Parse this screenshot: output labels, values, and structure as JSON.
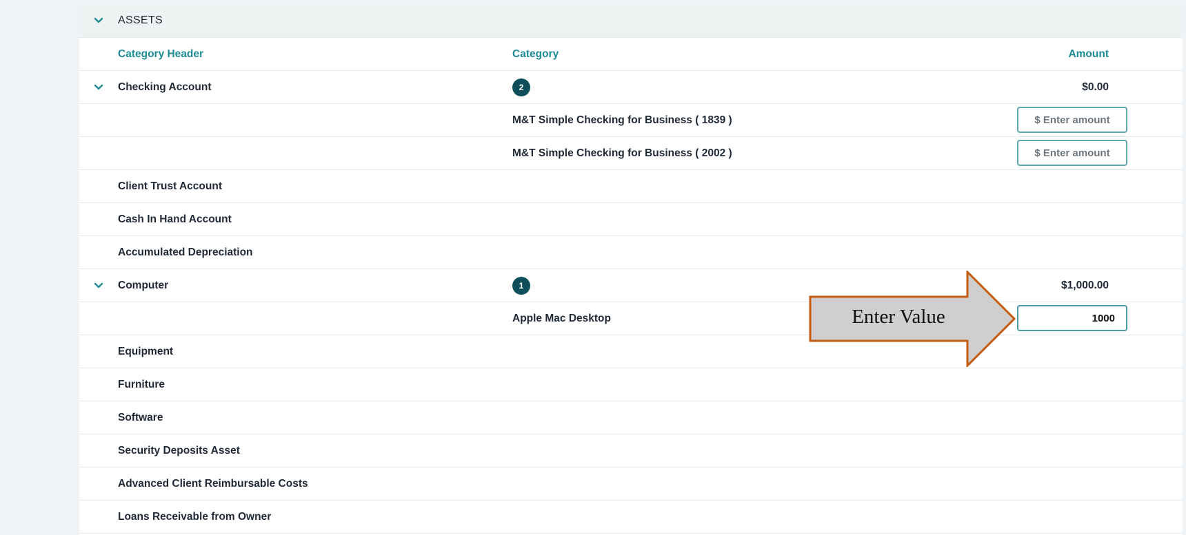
{
  "section": {
    "title": "ASSETS"
  },
  "columns": {
    "header": "Category Header",
    "category": "Category",
    "amount": "Amount"
  },
  "rows": {
    "checking": {
      "label": "Checking Account",
      "count": "2",
      "amount": "$0.00"
    },
    "checking_1": {
      "category": "M&T Simple Checking for Business ( 1839 )",
      "placeholder": "$ Enter amount",
      "value": ""
    },
    "checking_2": {
      "category": "M&T Simple Checking for Business ( 2002 )",
      "placeholder": "$ Enter amount",
      "value": ""
    },
    "client_trust": {
      "label": "Client Trust Account"
    },
    "cash_in_hand": {
      "label": "Cash In Hand Account"
    },
    "accum_dep": {
      "label": "Accumulated Depreciation"
    },
    "computer": {
      "label": "Computer",
      "count": "1",
      "amount": "$1,000.00"
    },
    "computer_1": {
      "category": "Apple Mac Desktop",
      "value": "1000"
    },
    "equipment": {
      "label": "Equipment"
    },
    "furniture": {
      "label": "Furniture"
    },
    "software": {
      "label": "Software"
    },
    "security_deposits": {
      "label": "Security Deposits Asset"
    },
    "advanced_client": {
      "label": "Advanced Client Reimbursable Costs"
    },
    "loans_receivable": {
      "label": "Loans Receivable from Owner"
    }
  },
  "callout": {
    "text": "Enter Value"
  },
  "colors": {
    "accent": "#1d8a94",
    "badge": "#0f4f5b",
    "callout_fill": "#d0cece",
    "callout_stroke": "#c55a11"
  }
}
